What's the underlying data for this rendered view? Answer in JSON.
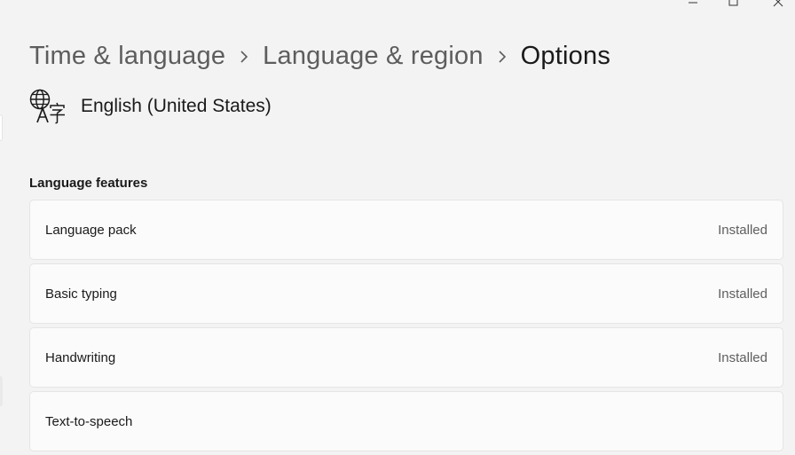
{
  "window": {
    "caption_icons": [
      "minimize-icon",
      "maximize-icon",
      "close-icon"
    ]
  },
  "breadcrumb": {
    "items": [
      {
        "label": "Time & language"
      },
      {
        "label": "Language & region"
      },
      {
        "label": "Options"
      }
    ]
  },
  "language": {
    "icon": "language-icon",
    "name": "English (United States)"
  },
  "features": {
    "title": "Language features",
    "items": [
      {
        "label": "Language pack",
        "status": "Installed"
      },
      {
        "label": "Basic typing",
        "status": "Installed"
      },
      {
        "label": "Handwriting",
        "status": "Installed"
      },
      {
        "label": "Text-to-speech",
        "status": ""
      }
    ]
  }
}
